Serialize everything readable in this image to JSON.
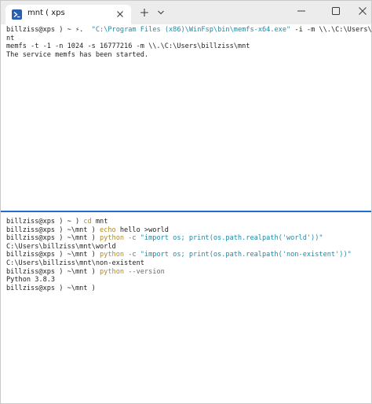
{
  "window": {
    "tab_title": "mnt ( xps",
    "icons": {
      "tab": "powershell-icon",
      "close_tab": "close-icon",
      "new_tab": "plus-icon",
      "dropdown": "chevron-down-icon",
      "minimize": "minimize-icon",
      "maximize": "maximize-icon",
      "close": "close-icon"
    }
  },
  "colors": {
    "divider": "#1e6fd0",
    "command": "#b08a2c",
    "string": "#1b8aa8",
    "text": "#1e1e1e"
  },
  "top_pane": {
    "line1": {
      "prompt": "billziss@xps ) ~ ",
      "cmd": "⚡.",
      "space": "  ",
      "str": "\"C:\\Program Files (x86)\\WinFsp\\bin\\memfs-x64.exe\"",
      "rest": " -i -m \\\\.\\C:\\Users\\billziss\\m"
    },
    "line2": "nt",
    "line3": "memfs -t -1 -n 1024 -s 16777216 -m \\\\.\\C:\\Users\\billziss\\mnt",
    "line4": "The service memfs has been started."
  },
  "bottom_pane": {
    "line1": {
      "prompt": "billziss@xps ) ~ ) ",
      "cmd": "cd",
      "rest": " mnt"
    },
    "line2": {
      "prompt": "billziss@xps ) ~\\mnt ) ",
      "cmd": "echo",
      "rest": " hello >world"
    },
    "line3": {
      "prompt": "billziss@xps ) ~\\mnt ) ",
      "cmd": "python",
      "arg": " -c ",
      "str": "\"import os; print(os.path.realpath('world'))\""
    },
    "line4": "C:\\Users\\billziss\\mnt\\world",
    "line5": {
      "prompt": "billziss@xps ) ~\\mnt ) ",
      "cmd": "python",
      "arg": " -c ",
      "str": "\"import os; print(os.path.realpath('non-existent'))\""
    },
    "line6": "C:\\Users\\billziss\\mnt\\non-existent",
    "line7": {
      "prompt": "billziss@xps ) ~\\mnt ) ",
      "cmd": "python",
      "arg": " --version"
    },
    "line8": "Python 3.8.3",
    "line9": {
      "prompt": "billziss@xps ) ~\\mnt ) "
    }
  }
}
